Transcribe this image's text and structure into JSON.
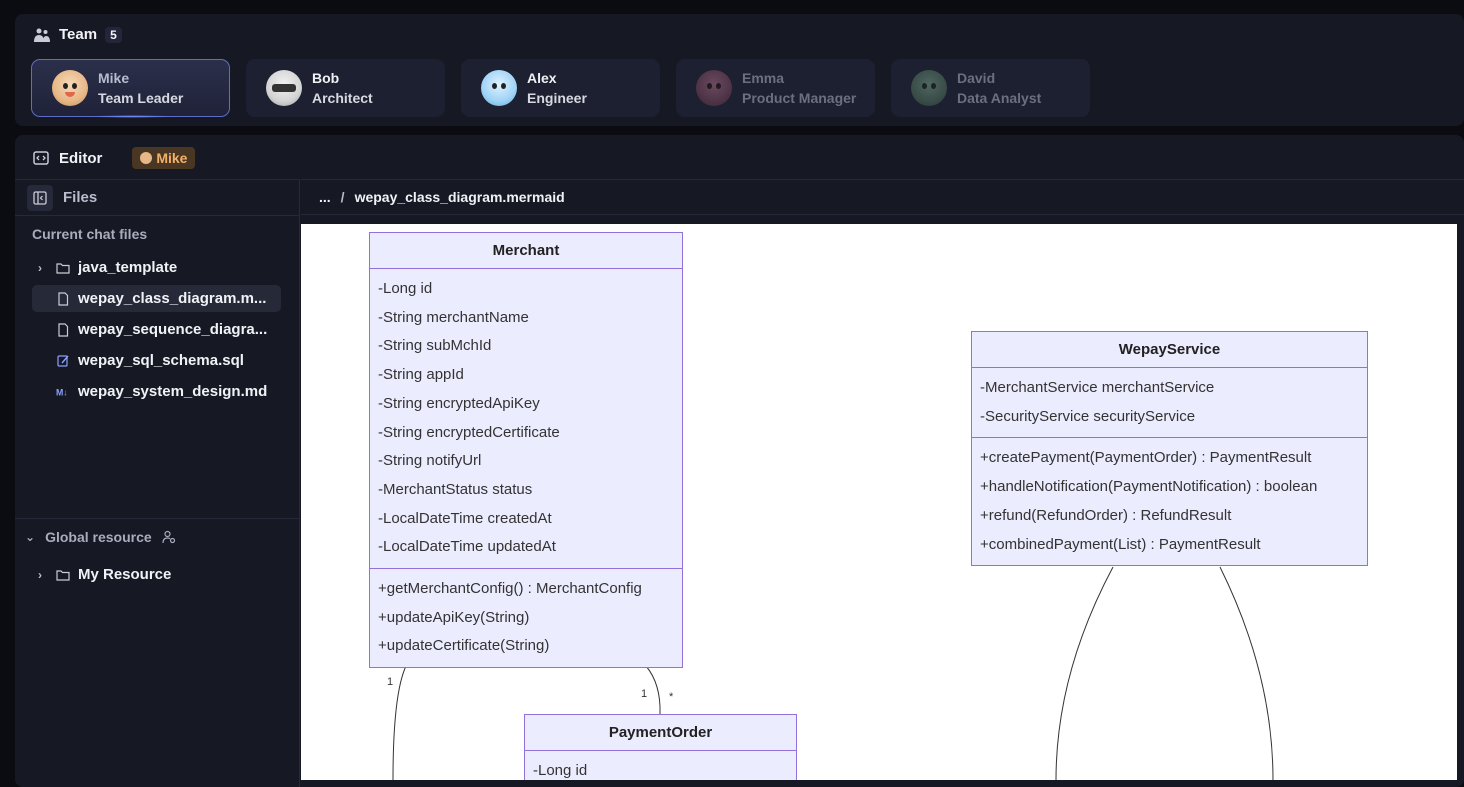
{
  "team": {
    "title": "Team",
    "count": "5",
    "members": [
      {
        "name": "Mike",
        "role": "Team Leader"
      },
      {
        "name": "Bob",
        "role": "Architect"
      },
      {
        "name": "Alex",
        "role": "Engineer"
      },
      {
        "name": "Emma",
        "role": "Product Manager"
      },
      {
        "name": "David",
        "role": "Data Analyst"
      }
    ]
  },
  "editor": {
    "title": "Editor",
    "owner": "Mike"
  },
  "sidebar": {
    "files_label": "Files",
    "current_files_label": "Current chat files",
    "items": [
      {
        "label": "java_template",
        "type": "folder"
      },
      {
        "label": "wepay_class_diagram.m...",
        "type": "file"
      },
      {
        "label": "wepay_sequence_diagra...",
        "type": "file"
      },
      {
        "label": "wepay_sql_schema.sql",
        "type": "sql"
      },
      {
        "label": "wepay_system_design.md",
        "type": "markdown"
      }
    ],
    "global_label": "Global resource",
    "global_items": [
      {
        "label": "My Resource",
        "type": "folder"
      }
    ]
  },
  "breadcrumb": {
    "ellipsis": "...",
    "separator": "/",
    "file": "wepay_class_diagram.mermaid"
  },
  "diagram": {
    "merchant": {
      "name": "Merchant",
      "fields": [
        "-Long id",
        "-String merchantName",
        "-String subMchId",
        "-String appId",
        "-String encryptedApiKey",
        "-String encryptedCertificate",
        "-String notifyUrl",
        "-MerchantStatus status",
        "-LocalDateTime createdAt",
        "-LocalDateTime updatedAt"
      ],
      "methods": [
        "+getMerchantConfig() : MerchantConfig",
        "+updateApiKey(String)",
        "+updateCertificate(String)"
      ]
    },
    "wepay_service": {
      "name": "WepayService",
      "fields": [
        "-MerchantService merchantService",
        "-SecurityService securityService"
      ],
      "methods": [
        "+createPayment(PaymentOrder) : PaymentResult",
        "+handleNotification(PaymentNotification) : boolean",
        "+refund(RefundOrder) : RefundResult",
        "+combinedPayment(List) : PaymentResult"
      ]
    },
    "payment_order": {
      "name": "PaymentOrder",
      "fields": [
        "-Long id"
      ]
    },
    "labels": {
      "one_a": "1",
      "one_b": "1",
      "many": "*"
    }
  }
}
